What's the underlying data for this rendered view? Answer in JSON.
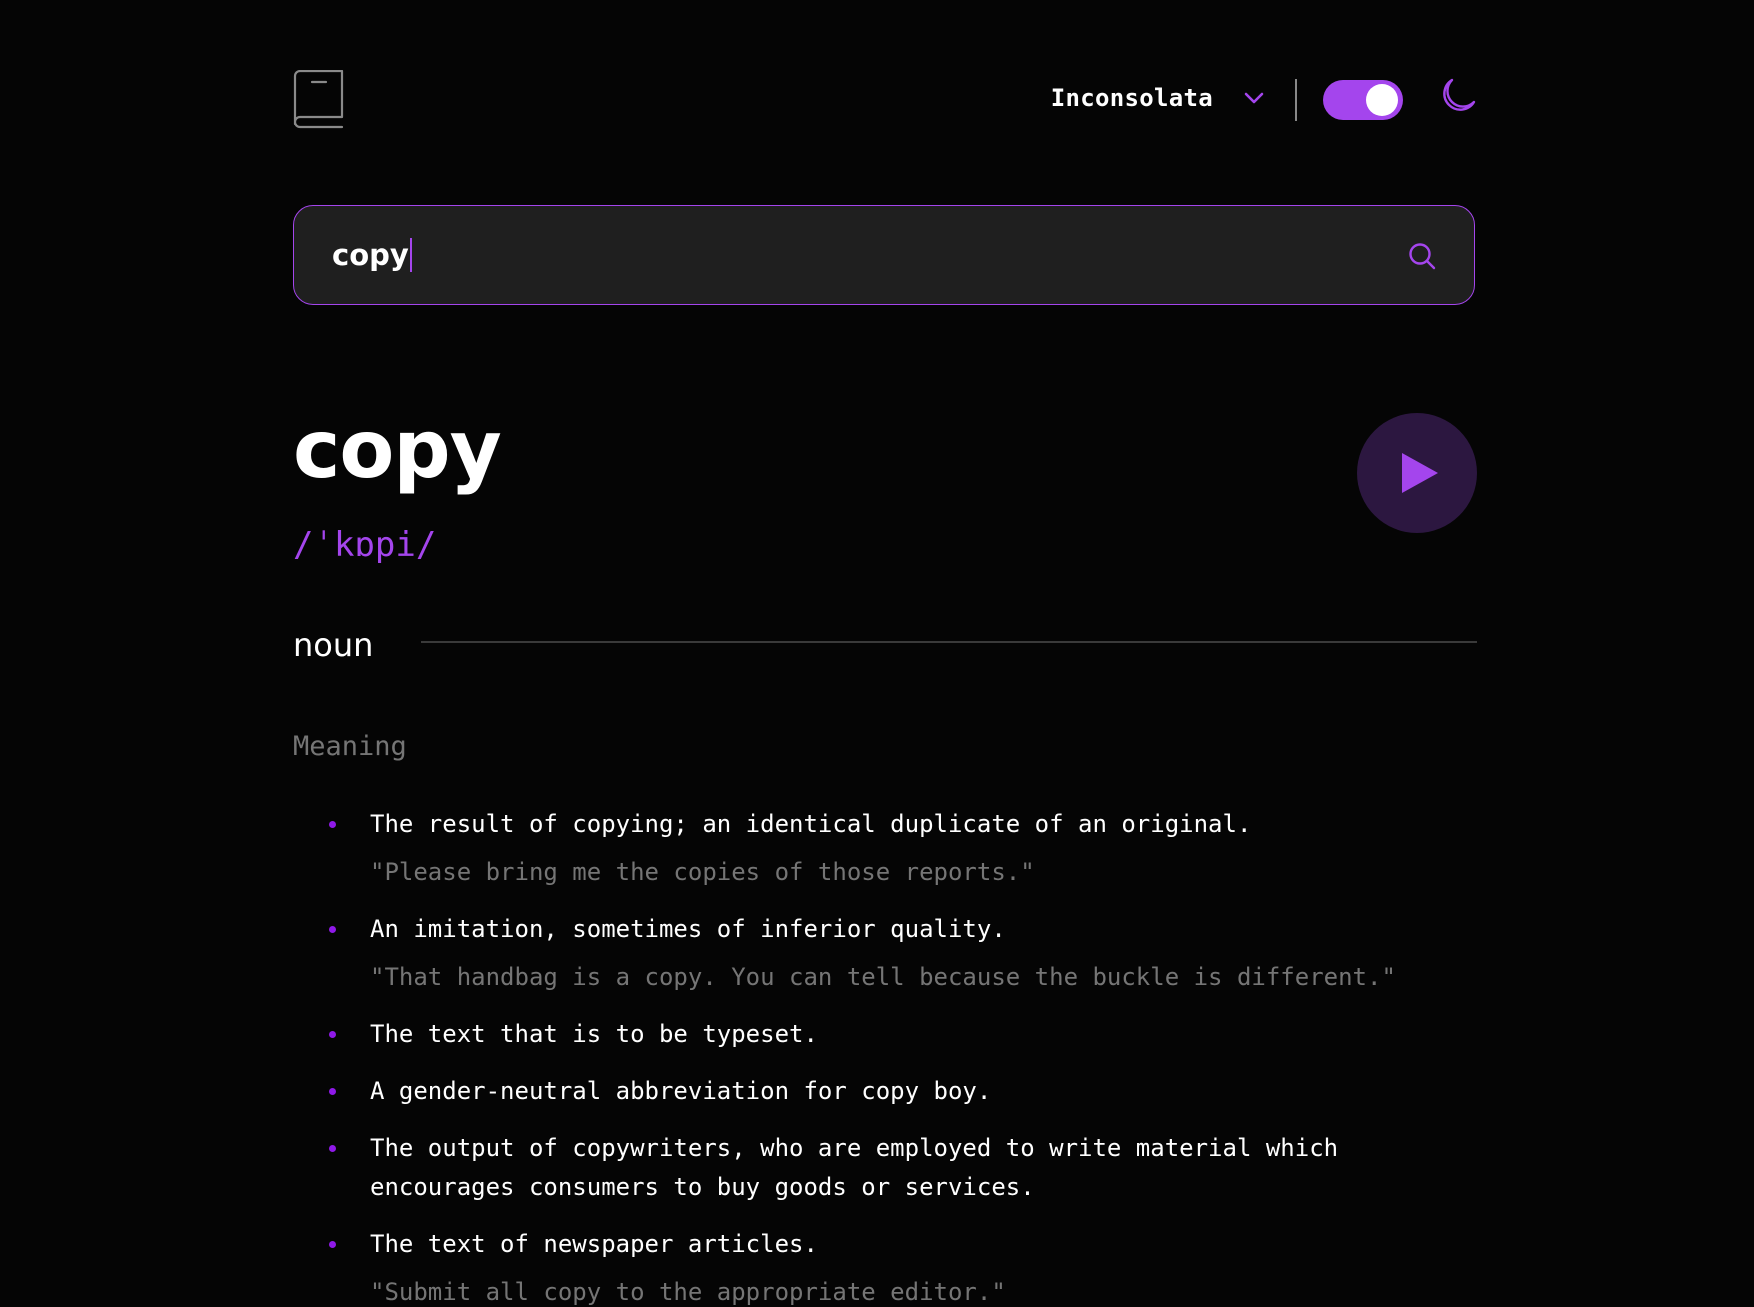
{
  "header": {
    "font_label": "Inconsolata",
    "theme_toggle_on": true
  },
  "search": {
    "value": "copy"
  },
  "entry": {
    "word": "copy",
    "phonetic": "/ˈkɒpi/",
    "part_of_speech": "noun",
    "meaning_label": "Meaning",
    "definitions": [
      {
        "text": "The result of copying; an identical duplicate of an original.",
        "example": "\"Please bring me the copies of those reports.\""
      },
      {
        "text": "An imitation, sometimes of inferior quality.",
        "example": "\"That handbag is a copy. You can tell because the buckle is different.\""
      },
      {
        "text": "The text that is to be typeset."
      },
      {
        "text": "A gender-neutral abbreviation for copy boy."
      },
      {
        "text": "The output of copywriters, who are employed to write material which encourages consumers to buy goods or services."
      },
      {
        "text": "The text of newspaper articles.",
        "example": "\"Submit all copy to the appropriate editor.\""
      }
    ]
  },
  "colors": {
    "accent": "#a445ed",
    "background": "#050505",
    "search_bg": "#1f1f1f",
    "muted": "#757575"
  }
}
